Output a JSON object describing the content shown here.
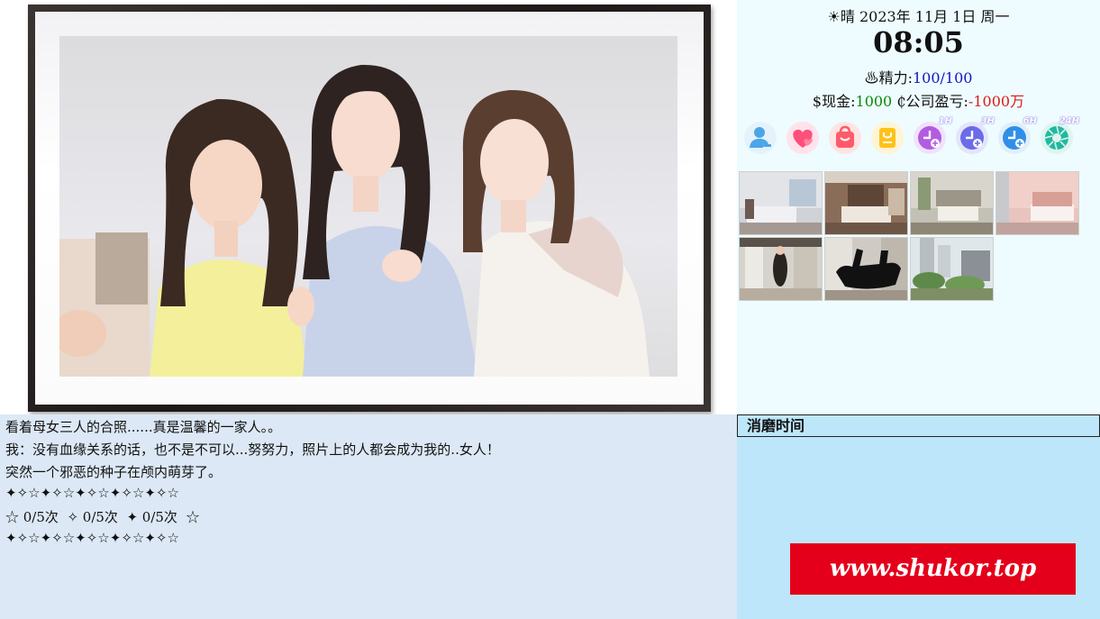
{
  "status": {
    "weather_icon": "sun-icon",
    "weather_glyph": "☀",
    "weather": "晴",
    "date": " 2023年 11月 1日 周一",
    "time": "08:05",
    "energy_glyph": "♨",
    "energy_label": "精力:",
    "energy_value": "100/100",
    "cash_glyph": "$",
    "cash_label": "现金:",
    "cash_value": "1000",
    "company_glyph": "₵",
    "company_label": "公司盈亏:",
    "company_value": "-1000万",
    "colors": {
      "energy": "#1515c8",
      "cash": "#0a8a0a",
      "company": "#e01818"
    }
  },
  "actions": [
    {
      "icon": "user-icon",
      "color": "#4aa6e8"
    },
    {
      "icon": "heart-icon",
      "color": "#ff4f7b"
    },
    {
      "icon": "shopping-bag-icon",
      "color": "#ff5a6a"
    },
    {
      "icon": "note-bag-icon",
      "color": "#ffc21a"
    },
    {
      "icon": "clock-1h-icon",
      "tag": "1H",
      "color": "#b25ce0"
    },
    {
      "icon": "clock-3h-icon",
      "tag": "3H",
      "color": "#6a6ce8"
    },
    {
      "icon": "clock-6h-icon",
      "tag": "6H",
      "color": "#2f8fe8"
    },
    {
      "icon": "clock-24h-icon",
      "tag": "24H",
      "color": "#22b8a0"
    }
  ],
  "locations": [
    {
      "icon": "bedroom-1-thumbnail"
    },
    {
      "icon": "bedroom-2-thumbnail"
    },
    {
      "icon": "bedroom-3-thumbnail"
    },
    {
      "icon": "bedroom-4-thumbnail"
    },
    {
      "icon": "hallway-thumbnail"
    },
    {
      "icon": "bathroom-thumbnail"
    },
    {
      "icon": "courtyard-thumbnail"
    }
  ],
  "dialogue": {
    "lines": [
      "看着母女三人的合照......真是温馨的一家人。。",
      "我：没有血缘关系的话，也不是不可以...努努力，照片上的人都会成为我的..女人！",
      "突然一个邪恶的种子在颅内萌芽了。",
      "✦✧☆✦✧☆✦✧☆✦✧☆✦✧☆",
      "☆ 0/5次  ✧ 0/5次  ✦ 0/5次  ☆",
      "✦✧☆✦✧☆✦✧☆✦✧☆✦✧☆"
    ]
  },
  "time_panel": {
    "title": "消磨时间",
    "watermark": "www.shukor.top"
  }
}
